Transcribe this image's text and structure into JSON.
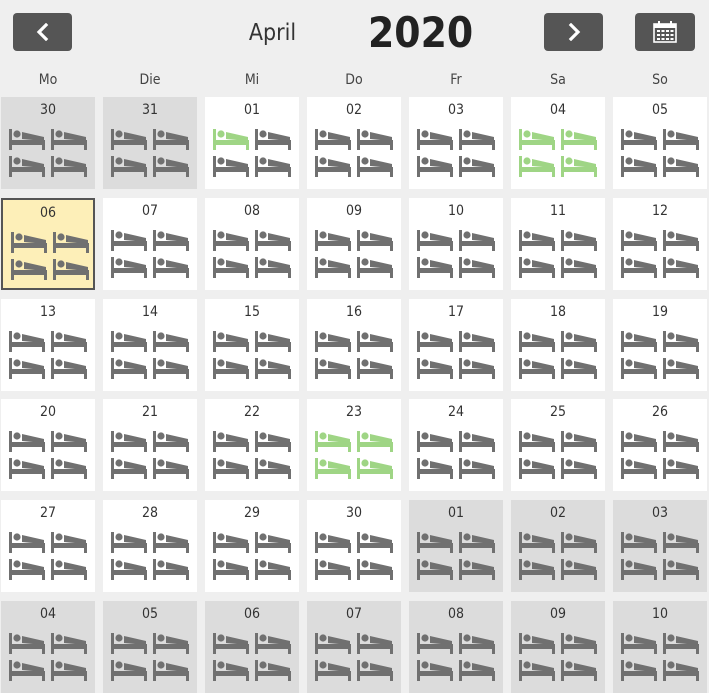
{
  "header": {
    "month": "April",
    "year": "2020"
  },
  "weekdays": [
    "Mo",
    "Die",
    "Mi",
    "Do",
    "Fr",
    "Sa",
    "So"
  ],
  "colors": {
    "bed_default": "#707070",
    "bed_free": "#9fd585",
    "today_bg": "#fdefb8",
    "other_month_bg": "#dcdcdc"
  },
  "icons": {
    "prev": "chevron-left-icon",
    "next": "chevron-right-icon",
    "calendar": "calendar-icon",
    "bed": "bed-icon"
  },
  "weeks": [
    [
      {
        "day": "30",
        "status": "other",
        "beds": [
          "b",
          "b",
          "b",
          "b"
        ]
      },
      {
        "day": "31",
        "status": "other",
        "beds": [
          "b",
          "b",
          "b",
          "b"
        ]
      },
      {
        "day": "01",
        "status": "current",
        "beds": [
          "g",
          "b",
          "b",
          "b"
        ]
      },
      {
        "day": "02",
        "status": "current",
        "beds": [
          "b",
          "b",
          "b",
          "b"
        ]
      },
      {
        "day": "03",
        "status": "current",
        "beds": [
          "b",
          "b",
          "b",
          "b"
        ]
      },
      {
        "day": "04",
        "status": "current",
        "beds": [
          "g",
          "g",
          "g",
          "g"
        ]
      },
      {
        "day": "05",
        "status": "current",
        "beds": [
          "b",
          "b",
          "b",
          "b"
        ]
      }
    ],
    [
      {
        "day": "06",
        "status": "today",
        "beds": [
          "b",
          "b",
          "b",
          "b"
        ]
      },
      {
        "day": "07",
        "status": "current",
        "beds": [
          "b",
          "b",
          "b",
          "b"
        ]
      },
      {
        "day": "08",
        "status": "current",
        "beds": [
          "b",
          "b",
          "b",
          "b"
        ]
      },
      {
        "day": "09",
        "status": "current",
        "beds": [
          "b",
          "b",
          "b",
          "b"
        ]
      },
      {
        "day": "10",
        "status": "current",
        "beds": [
          "b",
          "b",
          "b",
          "b"
        ]
      },
      {
        "day": "11",
        "status": "current",
        "beds": [
          "b",
          "b",
          "b",
          "b"
        ]
      },
      {
        "day": "12",
        "status": "current",
        "beds": [
          "b",
          "b",
          "b",
          "b"
        ]
      }
    ],
    [
      {
        "day": "13",
        "status": "current",
        "beds": [
          "b",
          "b",
          "b",
          "b"
        ]
      },
      {
        "day": "14",
        "status": "current",
        "beds": [
          "b",
          "b",
          "b",
          "b"
        ]
      },
      {
        "day": "15",
        "status": "current",
        "beds": [
          "b",
          "b",
          "b",
          "b"
        ]
      },
      {
        "day": "16",
        "status": "current",
        "beds": [
          "b",
          "b",
          "b",
          "b"
        ]
      },
      {
        "day": "17",
        "status": "current",
        "beds": [
          "b",
          "b",
          "b",
          "b"
        ]
      },
      {
        "day": "18",
        "status": "current",
        "beds": [
          "b",
          "b",
          "b",
          "b"
        ]
      },
      {
        "day": "19",
        "status": "current",
        "beds": [
          "b",
          "b",
          "b",
          "b"
        ]
      }
    ],
    [
      {
        "day": "20",
        "status": "current",
        "beds": [
          "b",
          "b",
          "b",
          "b"
        ]
      },
      {
        "day": "21",
        "status": "current",
        "beds": [
          "b",
          "b",
          "b",
          "b"
        ]
      },
      {
        "day": "22",
        "status": "current",
        "beds": [
          "b",
          "b",
          "b",
          "b"
        ]
      },
      {
        "day": "23",
        "status": "current",
        "beds": [
          "g",
          "g",
          "g",
          "g"
        ]
      },
      {
        "day": "24",
        "status": "current",
        "beds": [
          "b",
          "b",
          "b",
          "b"
        ]
      },
      {
        "day": "25",
        "status": "current",
        "beds": [
          "b",
          "b",
          "b",
          "b"
        ]
      },
      {
        "day": "26",
        "status": "current",
        "beds": [
          "b",
          "b",
          "b",
          "b"
        ]
      }
    ],
    [
      {
        "day": "27",
        "status": "current",
        "beds": [
          "b",
          "b",
          "b",
          "b"
        ]
      },
      {
        "day": "28",
        "status": "current",
        "beds": [
          "b",
          "b",
          "b",
          "b"
        ]
      },
      {
        "day": "29",
        "status": "current",
        "beds": [
          "b",
          "b",
          "b",
          "b"
        ]
      },
      {
        "day": "30",
        "status": "current",
        "beds": [
          "b",
          "b",
          "b",
          "b"
        ]
      },
      {
        "day": "01",
        "status": "other",
        "beds": [
          "b",
          "b",
          "b",
          "b"
        ]
      },
      {
        "day": "02",
        "status": "other",
        "beds": [
          "b",
          "b",
          "b",
          "b"
        ]
      },
      {
        "day": "03",
        "status": "other",
        "beds": [
          "b",
          "b",
          "b",
          "b"
        ]
      }
    ],
    [
      {
        "day": "04",
        "status": "other",
        "beds": [
          "b",
          "b",
          "b",
          "b"
        ]
      },
      {
        "day": "05",
        "status": "other",
        "beds": [
          "b",
          "b",
          "b",
          "b"
        ]
      },
      {
        "day": "06",
        "status": "other",
        "beds": [
          "b",
          "b",
          "b",
          "b"
        ]
      },
      {
        "day": "07",
        "status": "other",
        "beds": [
          "b",
          "b",
          "b",
          "b"
        ]
      },
      {
        "day": "08",
        "status": "other",
        "beds": [
          "b",
          "b",
          "b",
          "b"
        ]
      },
      {
        "day": "09",
        "status": "other",
        "beds": [
          "b",
          "b",
          "b",
          "b"
        ]
      },
      {
        "day": "10",
        "status": "other",
        "beds": [
          "b",
          "b",
          "b",
          "b"
        ]
      }
    ]
  ]
}
